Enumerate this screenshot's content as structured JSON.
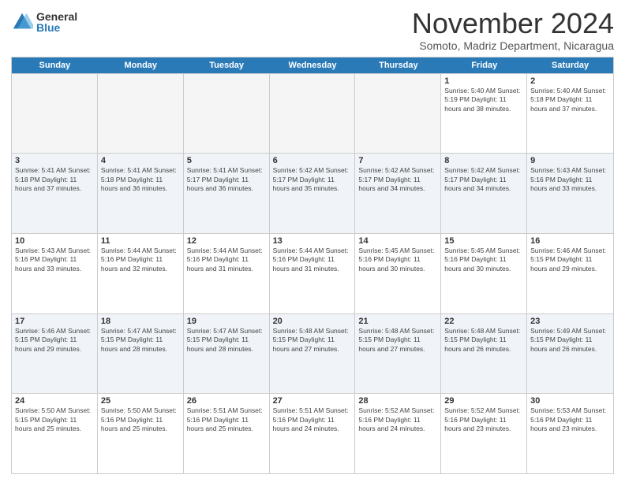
{
  "logo": {
    "general": "General",
    "blue": "Blue"
  },
  "title": "November 2024",
  "location": "Somoto, Madriz Department, Nicaragua",
  "days_of_week": [
    "Sunday",
    "Monday",
    "Tuesday",
    "Wednesday",
    "Thursday",
    "Friday",
    "Saturday"
  ],
  "weeks": [
    [
      {
        "day": "",
        "info": ""
      },
      {
        "day": "",
        "info": ""
      },
      {
        "day": "",
        "info": ""
      },
      {
        "day": "",
        "info": ""
      },
      {
        "day": "",
        "info": ""
      },
      {
        "day": "1",
        "info": "Sunrise: 5:40 AM\nSunset: 5:19 PM\nDaylight: 11 hours\nand 38 minutes."
      },
      {
        "day": "2",
        "info": "Sunrise: 5:40 AM\nSunset: 5:18 PM\nDaylight: 11 hours\nand 37 minutes."
      }
    ],
    [
      {
        "day": "3",
        "info": "Sunrise: 5:41 AM\nSunset: 5:18 PM\nDaylight: 11 hours\nand 37 minutes."
      },
      {
        "day": "4",
        "info": "Sunrise: 5:41 AM\nSunset: 5:18 PM\nDaylight: 11 hours\nand 36 minutes."
      },
      {
        "day": "5",
        "info": "Sunrise: 5:41 AM\nSunset: 5:17 PM\nDaylight: 11 hours\nand 36 minutes."
      },
      {
        "day": "6",
        "info": "Sunrise: 5:42 AM\nSunset: 5:17 PM\nDaylight: 11 hours\nand 35 minutes."
      },
      {
        "day": "7",
        "info": "Sunrise: 5:42 AM\nSunset: 5:17 PM\nDaylight: 11 hours\nand 34 minutes."
      },
      {
        "day": "8",
        "info": "Sunrise: 5:42 AM\nSunset: 5:17 PM\nDaylight: 11 hours\nand 34 minutes."
      },
      {
        "day": "9",
        "info": "Sunrise: 5:43 AM\nSunset: 5:16 PM\nDaylight: 11 hours\nand 33 minutes."
      }
    ],
    [
      {
        "day": "10",
        "info": "Sunrise: 5:43 AM\nSunset: 5:16 PM\nDaylight: 11 hours\nand 33 minutes."
      },
      {
        "day": "11",
        "info": "Sunrise: 5:44 AM\nSunset: 5:16 PM\nDaylight: 11 hours\nand 32 minutes."
      },
      {
        "day": "12",
        "info": "Sunrise: 5:44 AM\nSunset: 5:16 PM\nDaylight: 11 hours\nand 31 minutes."
      },
      {
        "day": "13",
        "info": "Sunrise: 5:44 AM\nSunset: 5:16 PM\nDaylight: 11 hours\nand 31 minutes."
      },
      {
        "day": "14",
        "info": "Sunrise: 5:45 AM\nSunset: 5:16 PM\nDaylight: 11 hours\nand 30 minutes."
      },
      {
        "day": "15",
        "info": "Sunrise: 5:45 AM\nSunset: 5:16 PM\nDaylight: 11 hours\nand 30 minutes."
      },
      {
        "day": "16",
        "info": "Sunrise: 5:46 AM\nSunset: 5:15 PM\nDaylight: 11 hours\nand 29 minutes."
      }
    ],
    [
      {
        "day": "17",
        "info": "Sunrise: 5:46 AM\nSunset: 5:15 PM\nDaylight: 11 hours\nand 29 minutes."
      },
      {
        "day": "18",
        "info": "Sunrise: 5:47 AM\nSunset: 5:15 PM\nDaylight: 11 hours\nand 28 minutes."
      },
      {
        "day": "19",
        "info": "Sunrise: 5:47 AM\nSunset: 5:15 PM\nDaylight: 11 hours\nand 28 minutes."
      },
      {
        "day": "20",
        "info": "Sunrise: 5:48 AM\nSunset: 5:15 PM\nDaylight: 11 hours\nand 27 minutes."
      },
      {
        "day": "21",
        "info": "Sunrise: 5:48 AM\nSunset: 5:15 PM\nDaylight: 11 hours\nand 27 minutes."
      },
      {
        "day": "22",
        "info": "Sunrise: 5:48 AM\nSunset: 5:15 PM\nDaylight: 11 hours\nand 26 minutes."
      },
      {
        "day": "23",
        "info": "Sunrise: 5:49 AM\nSunset: 5:15 PM\nDaylight: 11 hours\nand 26 minutes."
      }
    ],
    [
      {
        "day": "24",
        "info": "Sunrise: 5:50 AM\nSunset: 5:15 PM\nDaylight: 11 hours\nand 25 minutes."
      },
      {
        "day": "25",
        "info": "Sunrise: 5:50 AM\nSunset: 5:16 PM\nDaylight: 11 hours\nand 25 minutes."
      },
      {
        "day": "26",
        "info": "Sunrise: 5:51 AM\nSunset: 5:16 PM\nDaylight: 11 hours\nand 25 minutes."
      },
      {
        "day": "27",
        "info": "Sunrise: 5:51 AM\nSunset: 5:16 PM\nDaylight: 11 hours\nand 24 minutes."
      },
      {
        "day": "28",
        "info": "Sunrise: 5:52 AM\nSunset: 5:16 PM\nDaylight: 11 hours\nand 24 minutes."
      },
      {
        "day": "29",
        "info": "Sunrise: 5:52 AM\nSunset: 5:16 PM\nDaylight: 11 hours\nand 23 minutes."
      },
      {
        "day": "30",
        "info": "Sunrise: 5:53 AM\nSunset: 5:16 PM\nDaylight: 11 hours\nand 23 minutes."
      }
    ]
  ]
}
